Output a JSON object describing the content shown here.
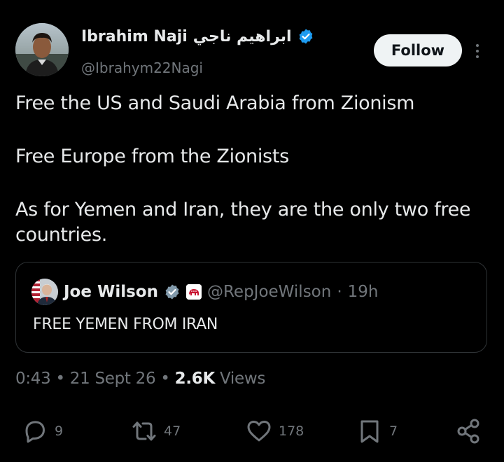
{
  "author": {
    "display_name": "Ibrahim Naji",
    "arabic_name": "ابراهيم ناجي",
    "handle": "@Ibrahym22Nagi",
    "verified": true
  },
  "follow_button": {
    "label": "Follow"
  },
  "more_menu": {
    "icon": "more-vertical-icon"
  },
  "tweet": {
    "paragraphs": [
      "Free the US and Saudi Arabia from Zionism",
      "Free Europe from the Zionists",
      "As for Yemen and Iran, they are the only two free countries."
    ]
  },
  "quote": {
    "name": "Joe Wilson",
    "handle": "@RepJoeWilson",
    "separator": "·",
    "time": "19h",
    "text": "FREE YEMEN FROM IRAN",
    "verified": true,
    "affiliate_badge": "gop-elephant-badge"
  },
  "meta": {
    "time": "0:43",
    "dot1": "•",
    "date": "21 Sept 26",
    "dot2": "•",
    "views_count": "2.6K",
    "views_label": "Views"
  },
  "actions": {
    "replies": "9",
    "reposts": "47",
    "likes": "178",
    "bookmarks": "7"
  },
  "colors": {
    "background": "#000000",
    "text": "#e7e9ea",
    "muted": "#71767b",
    "verified_blue": "#1d9bf0",
    "border": "#2f3336"
  }
}
